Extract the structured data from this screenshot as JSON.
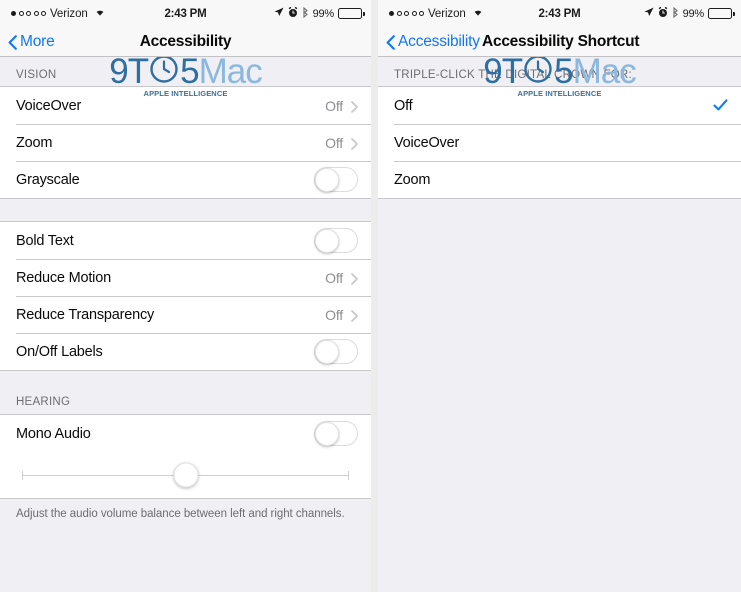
{
  "status_bar": {
    "carrier": "Verizon",
    "signal_dots_total": 5,
    "signal_dots_filled": 1,
    "wifi_icon": "wifi-icon",
    "time": "2:43 PM",
    "location_icon": "location-arrow-icon",
    "alarm_icon": "alarm-clock-icon",
    "bluetooth_icon": "bluetooth-icon",
    "battery_percent": "99%",
    "battery_level": 99
  },
  "watermark": {
    "part1": "9T",
    "clock_glyph": "clock-icon",
    "part2": "5",
    "part3": "Mac",
    "subtitle": "APPLE INTELLIGENCE",
    "color_dark": "#2e6fa3",
    "color_light": "#8bb8de"
  },
  "left_screen": {
    "nav": {
      "back_label": "More",
      "back_icon": "chevron-left-icon",
      "title": "Accessibility"
    },
    "sections": [
      {
        "header": "VISION",
        "rows": [
          {
            "label": "VoiceOver",
            "type": "disclosure",
            "value": "Off"
          },
          {
            "label": "Zoom",
            "type": "disclosure",
            "value": "Off"
          },
          {
            "label": "Grayscale",
            "type": "toggle",
            "on": false
          }
        ]
      },
      {
        "header": "",
        "rows": [
          {
            "label": "Bold Text",
            "type": "toggle",
            "on": false
          },
          {
            "label": "Reduce Motion",
            "type": "disclosure",
            "value": "Off"
          },
          {
            "label": "Reduce Transparency",
            "type": "disclosure",
            "value": "Off"
          },
          {
            "label": "On/Off Labels",
            "type": "toggle",
            "on": false
          }
        ]
      },
      {
        "header": "HEARING",
        "rows": [
          {
            "label": "Mono Audio",
            "type": "toggle",
            "on": false
          }
        ],
        "slider": {
          "value": 50,
          "min": 0,
          "max": 100
        },
        "footer": "Adjust the audio volume balance between left and right channels."
      }
    ]
  },
  "right_screen": {
    "nav": {
      "back_label": "Accessibility",
      "back_icon": "chevron-left-icon",
      "title": "Accessibility Shortcut"
    },
    "section_header": "TRIPLE-CLICK THE DIGITAL CROWN FOR:",
    "options": [
      {
        "label": "Off",
        "selected": true
      },
      {
        "label": "VoiceOver",
        "selected": false
      },
      {
        "label": "Zoom",
        "selected": false
      }
    ],
    "accent_color": "#1278f3",
    "check_color": "#0a7cf0"
  }
}
